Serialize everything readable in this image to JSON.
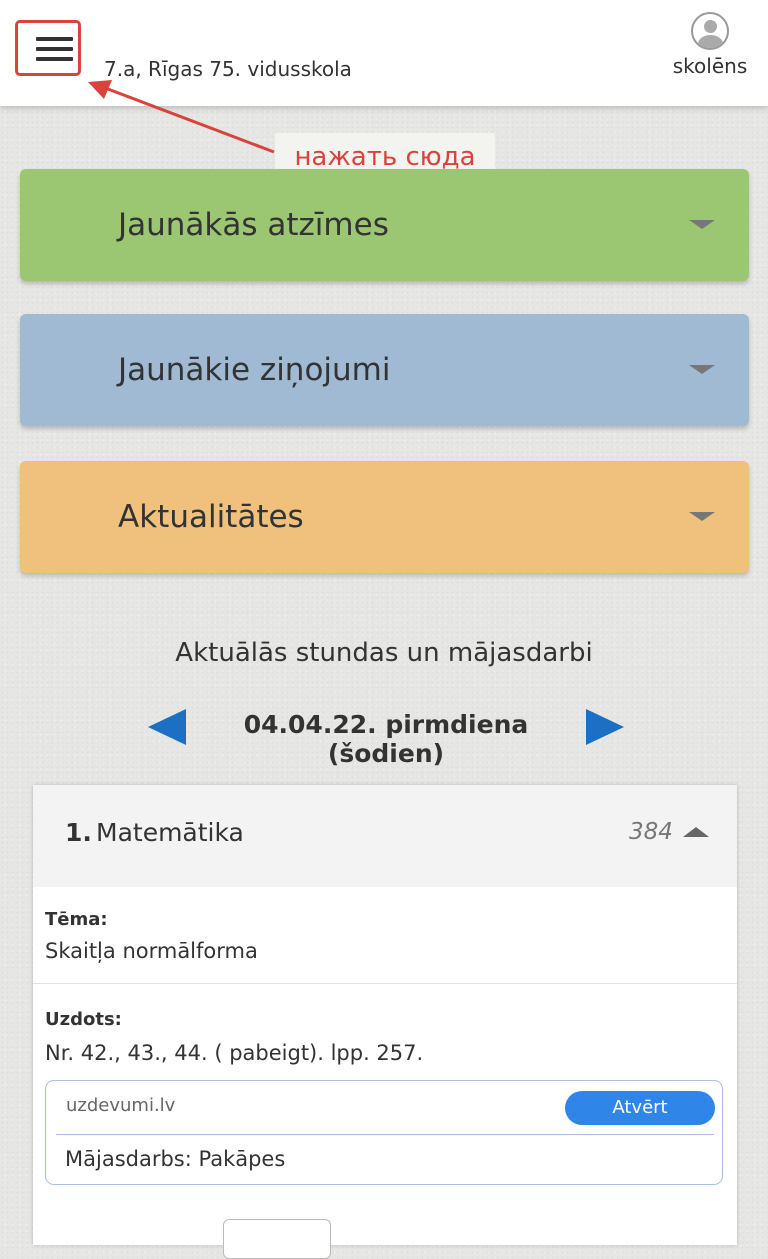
{
  "header": {
    "menu_icon": "hamburger-menu-icon",
    "school_name": "7.a, Rīgas 75. vidusskola",
    "profile_label": "skolēns",
    "profile_icon": "user-avatar-icon"
  },
  "annotation": {
    "label": "нажать сюда",
    "color": "#d9433e"
  },
  "accordions": [
    {
      "title": "Jaunākās atzīmes",
      "color": "#9bc772"
    },
    {
      "title": "Jaunākie ziņojumi",
      "color": "#9fbad2"
    },
    {
      "title": "Aktualitātes",
      "color": "#efc17d"
    }
  ],
  "lessons_section": {
    "title": "Aktuālās stundas un mājasdarbi",
    "date": "04.04.22. pirmdiena (šodien)",
    "nav_color": "#1c6fc2"
  },
  "lesson": {
    "number": "1.",
    "subject": "Matemātika",
    "room": "384",
    "topic_label": "Tēma:",
    "topic": "Skaitļa normālforma",
    "assigned_label": "Uzdots:",
    "assigned": "Nr. 42., 43., 44. ( pabeigt). lpp. 257.",
    "resource": {
      "site": "uzdevumi.lv",
      "open_label": "Atvērt",
      "task": "Mājasdarbs: Pakāpes"
    }
  }
}
